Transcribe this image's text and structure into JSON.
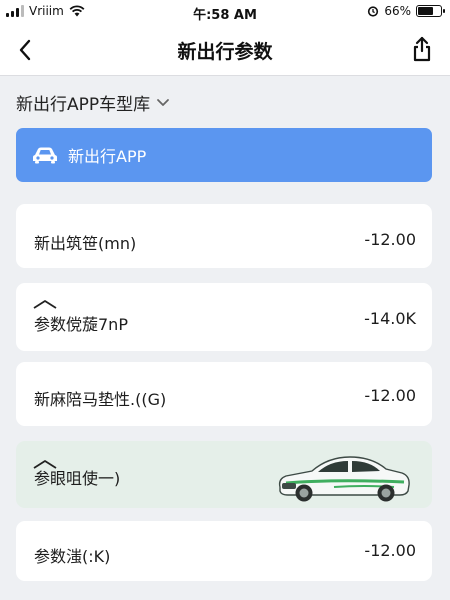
{
  "status_bar": {
    "carrier": "Vriiim",
    "time": "午:58 AM",
    "battery_text": "66%",
    "battery_level": 0.66
  },
  "nav": {
    "title": "新出行参数",
    "back_icon": "chevron-left-icon",
    "share_icon": "share-icon"
  },
  "library": {
    "label": "新出行APP车型库",
    "icon": "chevron-down-icon"
  },
  "banner": {
    "icon": "car-icon",
    "label": "新出行APP",
    "color": "#5b96f0"
  },
  "params": [
    {
      "label": "新出筑笹(mn)",
      "value": "-12.00"
    },
    {
      "label": "参数傥蔙7nP",
      "value": "-14.0K",
      "icon": "roof-icon"
    },
    {
      "label": "新麻陪马垫性.((G)",
      "value": "-12.00"
    },
    {
      "label": "参眼咀使一)",
      "value": "",
      "icon": "roof-icon",
      "illustration": "car-illustration"
    },
    {
      "label": "参数滍(:K)",
      "value": "-12.00"
    }
  ]
}
